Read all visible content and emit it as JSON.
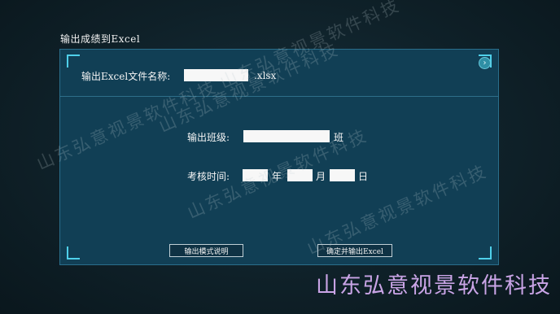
{
  "window": {
    "title": "输出成绩到Excel"
  },
  "form": {
    "filename_label": "输出Excel文件名称:",
    "filename_value": "",
    "filename_ext": ".xlsx",
    "class_label": "输出班级:",
    "class_value": "",
    "class_suffix": "班",
    "time_label": "考核时间:",
    "year_value": "",
    "year_unit": "年",
    "month_value": "",
    "month_unit": "月",
    "day_value": "",
    "day_unit": "日"
  },
  "buttons": {
    "mode_help": "输出模式说明",
    "confirm_export": "确定并输出Excel"
  },
  "icons": {
    "expand": "chevron-right-icon"
  },
  "watermark": {
    "text": "山东弘意视景软件科技"
  },
  "brand": {
    "text": "山东弘意视景软件科技"
  }
}
